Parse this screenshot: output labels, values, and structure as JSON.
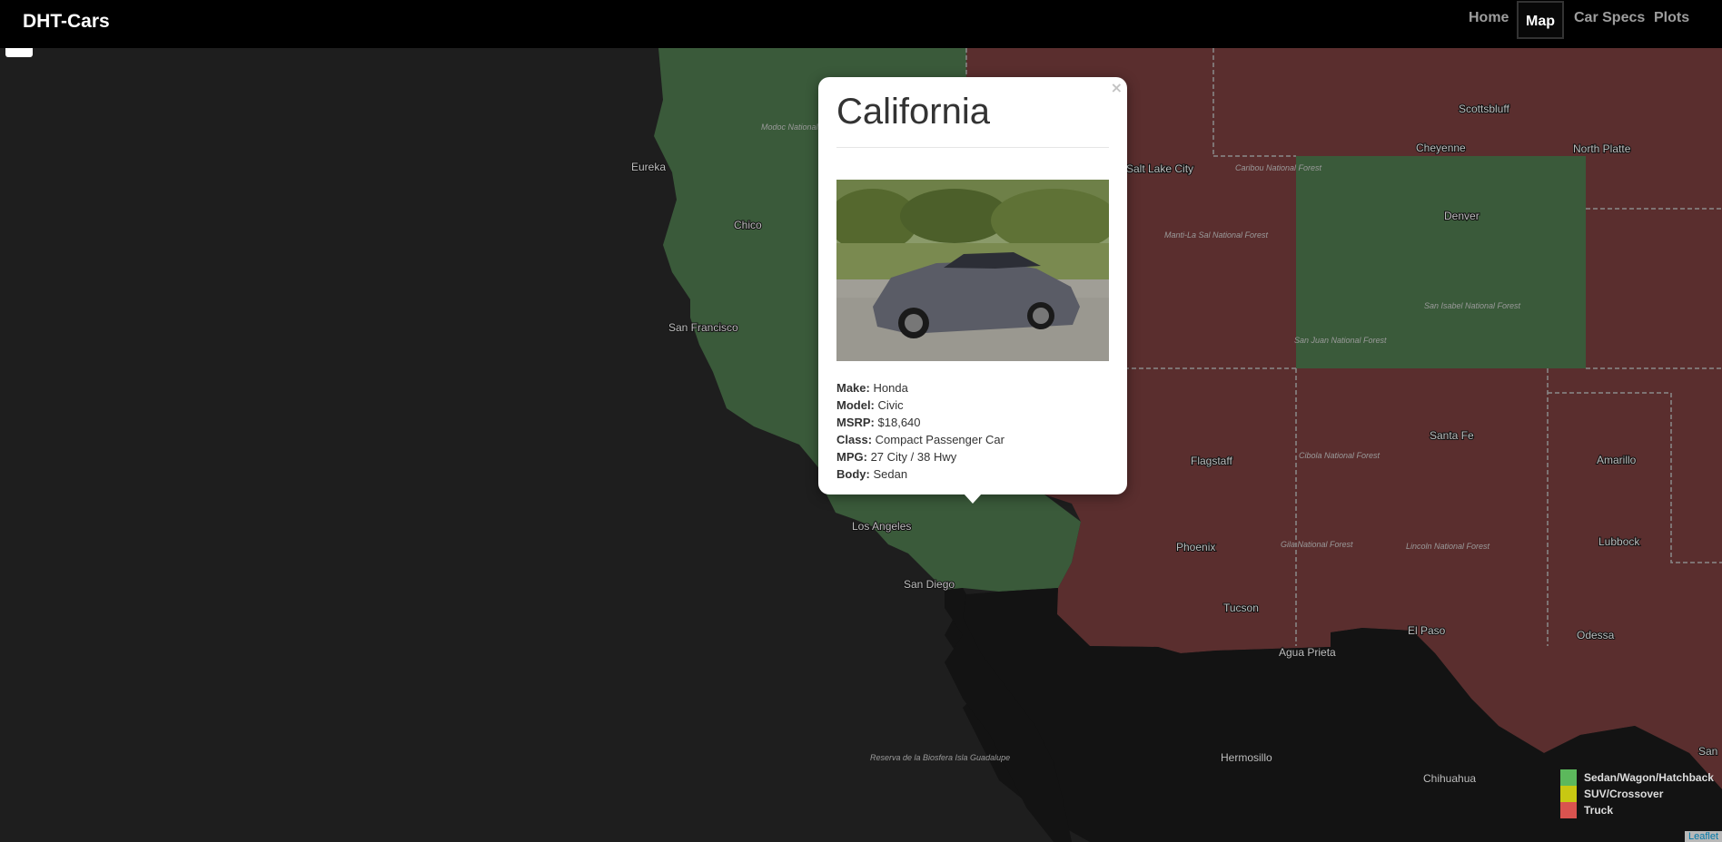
{
  "navbar": {
    "brand": "DHT-Cars",
    "links": [
      "Home",
      "Map",
      "Car Specs",
      "Plots"
    ],
    "active": "Map"
  },
  "map": {
    "colors": {
      "sedan": "#3a5a3a",
      "truck": "#5a2e2e",
      "ocean": "#1e1e1e",
      "land_other": "#131313"
    },
    "cities": [
      "Eureka",
      "Chico",
      "San Francisco",
      "Los Angeles",
      "San Diego",
      "Salt Lake City",
      "Scottsbluff",
      "Cheyenne",
      "North Platte",
      "Denver",
      "Flagstaff",
      "Phoenix",
      "Tucson",
      "Santa Fe",
      "Amarillo",
      "Lubbock",
      "El Paso",
      "Odessa",
      "Agua Prieta",
      "Hermosillo",
      "Chihuahua",
      "San"
    ],
    "forests": [
      "Modoc National Forest",
      "Caribou National Forest",
      "Manti-La Sal National Forest",
      "San Juan National Forest",
      "San Isabel National Forest",
      "Cibola National Forest",
      "Gila National Forest",
      "Lincoln National Forest",
      "Reserva de la Biosfera Isla Guadalupe"
    ]
  },
  "popup": {
    "close": "×",
    "title": "California",
    "specs": [
      {
        "label": "Make:",
        "value": "Honda"
      },
      {
        "label": "Model:",
        "value": "Civic"
      },
      {
        "label": "MSRP:",
        "value": "$18,640"
      },
      {
        "label": "Class:",
        "value": "Compact Passenger Car"
      },
      {
        "label": "MPG:",
        "value": "27 City / 38 Hwy"
      },
      {
        "label": "Body:",
        "value": "Sedan"
      }
    ]
  },
  "legend": [
    {
      "label": "Sedan/Wagon/Hatchback",
      "color": "#5cb85c"
    },
    {
      "label": "SUV/Crossover",
      "color": "#c8c812"
    },
    {
      "label": "Truck",
      "color": "#d9534f"
    }
  ],
  "attribution": "Leaflet"
}
